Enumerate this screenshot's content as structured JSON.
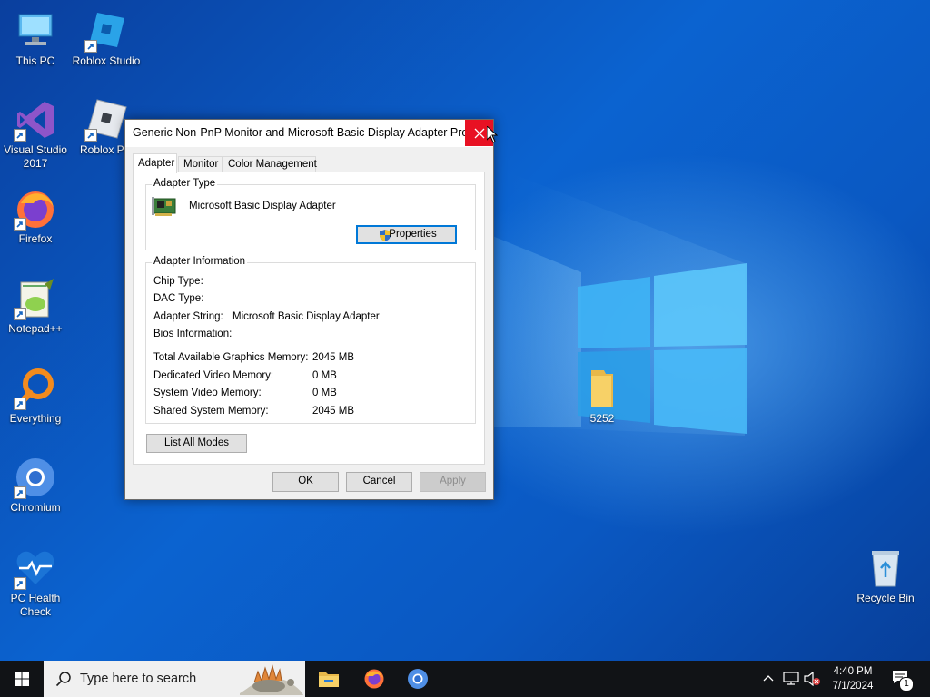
{
  "desktop": {
    "icons": [
      {
        "label": "This PC"
      },
      {
        "label": "Roblox Studio"
      },
      {
        "label": "Visual Studio 2017"
      },
      {
        "label": "Roblox Pla"
      },
      {
        "label": "Firefox"
      },
      {
        "label": "Notepad++"
      },
      {
        "label": "Everything"
      },
      {
        "label": "Chromium"
      },
      {
        "label": "PC Health Check"
      },
      {
        "label": "5252"
      },
      {
        "label": "Recycle Bin"
      }
    ]
  },
  "dialog": {
    "title": "Generic Non-PnP Monitor and Microsoft Basic Display Adapter Pro...",
    "tabs": [
      {
        "label": "Adapter",
        "active": true
      },
      {
        "label": "Monitor"
      },
      {
        "label": "Color Management"
      }
    ],
    "adapter_type": {
      "title": "Adapter Type",
      "name": "Microsoft Basic Display Adapter",
      "properties_label": "Properties"
    },
    "adapter_info": {
      "title": "Adapter Information",
      "rows": [
        {
          "label": "Chip Type:",
          "value": ""
        },
        {
          "label": "DAC Type:",
          "value": ""
        },
        {
          "label": "Adapter String:",
          "value": "Microsoft Basic Display Adapter"
        },
        {
          "label": "Bios Information:",
          "value": ""
        }
      ],
      "memory": [
        {
          "label": "Total Available Graphics Memory:",
          "value": "2045 MB"
        },
        {
          "label": "Dedicated Video Memory:",
          "value": "0 MB"
        },
        {
          "label": "System Video Memory:",
          "value": "0 MB"
        },
        {
          "label": "Shared System Memory:",
          "value": "2045 MB"
        }
      ]
    },
    "list_modes_label": "List All Modes",
    "ok_label": "OK",
    "cancel_label": "Cancel",
    "apply_label": "Apply"
  },
  "taskbar": {
    "search_placeholder": "Type here to search",
    "time": "4:40 PM",
    "date": "7/1/2024",
    "notification_count": "1"
  },
  "colors": {
    "close_button": "#e81123",
    "taskbar": "#111316",
    "accent": "#0078d7"
  }
}
